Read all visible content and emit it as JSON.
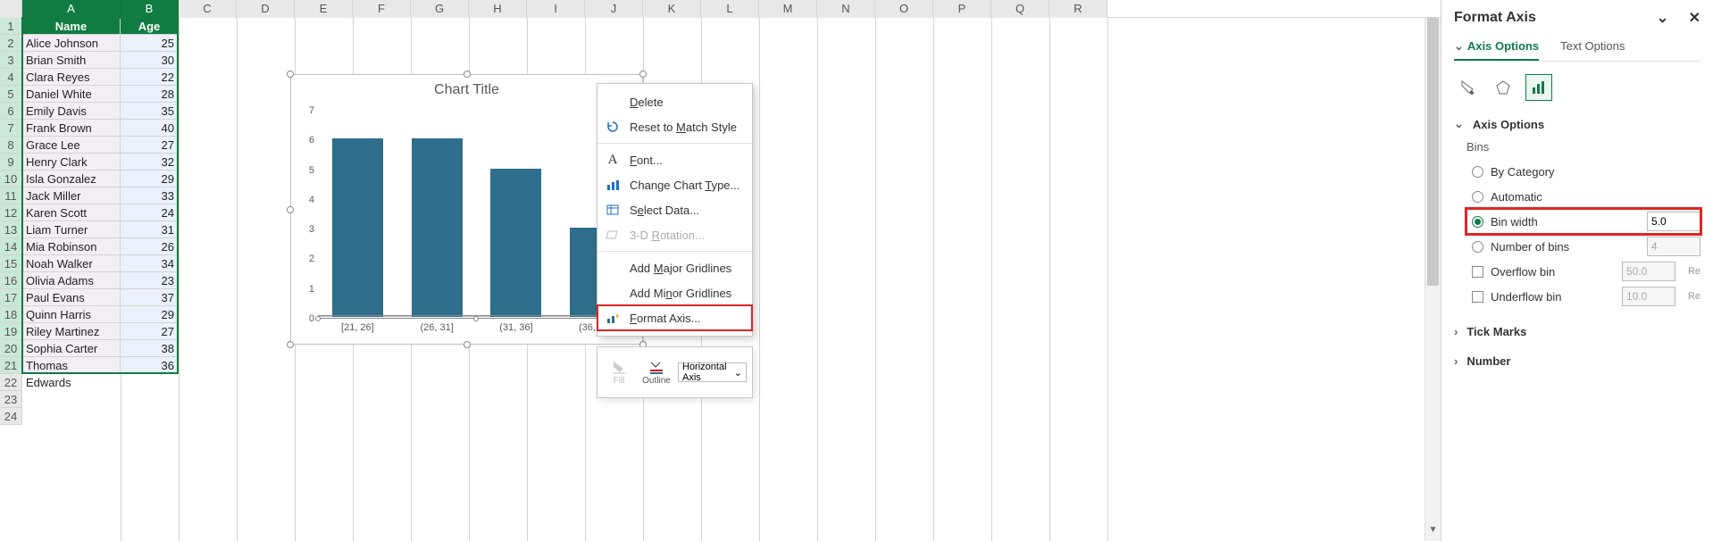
{
  "columns": [
    "A",
    "B",
    "C",
    "D",
    "E",
    "F",
    "G",
    "H",
    "I",
    "J",
    "K",
    "L",
    "M",
    "N",
    "O",
    "P",
    "Q",
    "R"
  ],
  "col_widths": {
    "A": 110,
    "B": 65
  },
  "default_col_width": 65,
  "headers": {
    "A": "Name",
    "B": "Age"
  },
  "rows": [
    {
      "name": "Alice Johnson",
      "age": 25
    },
    {
      "name": "Brian Smith",
      "age": 30
    },
    {
      "name": "Clara Reyes",
      "age": 22
    },
    {
      "name": "Daniel White",
      "age": 28
    },
    {
      "name": "Emily Davis",
      "age": 35
    },
    {
      "name": "Frank Brown",
      "age": 40
    },
    {
      "name": "Grace Lee",
      "age": 27
    },
    {
      "name": "Henry Clark",
      "age": 32
    },
    {
      "name": "Isla Gonzalez",
      "age": 29
    },
    {
      "name": "Jack Miller",
      "age": 33
    },
    {
      "name": "Karen Scott",
      "age": 24
    },
    {
      "name": "Liam Turner",
      "age": 31
    },
    {
      "name": "Mia Robinson",
      "age": 26
    },
    {
      "name": "Noah Walker",
      "age": 34
    },
    {
      "name": "Olivia Adams",
      "age": 23
    },
    {
      "name": "Paul Evans",
      "age": 37
    },
    {
      "name": "Quinn Harris",
      "age": 29
    },
    {
      "name": "Riley Martinez",
      "age": 27
    },
    {
      "name": "Sophia Carter",
      "age": 38
    },
    {
      "name": "Thomas Edwards",
      "age": 36
    }
  ],
  "visible_blank_rows": 3,
  "chart": {
    "title": "Chart Title",
    "y_ticks": [
      0,
      1,
      2,
      3,
      4,
      5,
      6,
      7
    ],
    "categories": [
      "[21, 26]",
      "(26, 31]",
      "(31, 36]",
      "(36, 41]"
    ],
    "values": [
      6,
      6,
      5,
      3
    ]
  },
  "context_menu": {
    "items": [
      {
        "label": "Delete",
        "u_index": 0,
        "icon": null,
        "enabled": true
      },
      {
        "label": "Reset to Match Style",
        "u_index": 9,
        "icon": "reset",
        "enabled": true
      },
      {
        "sep": true
      },
      {
        "label": "Font...",
        "u_index": 0,
        "icon": "font",
        "enabled": true
      },
      {
        "label": "Change Chart Type...",
        "u_index": 13,
        "icon": "chart-type",
        "enabled": true
      },
      {
        "label": "Select Data...",
        "u_index": 1,
        "icon": "select-data",
        "enabled": true
      },
      {
        "label": "3-D Rotation...",
        "u_index": 4,
        "icon": "rotate-3d",
        "enabled": false
      },
      {
        "sep": true
      },
      {
        "label": "Add Major Gridlines",
        "u_index": 4,
        "icon": null,
        "enabled": true
      },
      {
        "label": "Add Minor Gridlines",
        "u_index": 6,
        "icon": null,
        "enabled": true
      },
      {
        "label": "Format Axis...",
        "u_index": 0,
        "icon": "format-axis",
        "enabled": true,
        "highlight": true
      }
    ]
  },
  "mini_toolbar": {
    "fill": "Fill",
    "outline": "Outline",
    "dropdown": "Horizontal Axis"
  },
  "panel": {
    "title": "Format Axis",
    "tab_axis": "Axis Options",
    "tab_text": "Text Options",
    "section_axis_options": "Axis Options",
    "bins_label": "Bins",
    "opt_by_category": "By Category",
    "opt_automatic": "Automatic",
    "opt_bin_width": "Bin width",
    "bin_width_value": "5.0",
    "opt_num_bins": "Number of bins",
    "num_bins_value": "4",
    "opt_overflow": "Overflow bin",
    "overflow_value": "50.0",
    "opt_underflow": "Underflow bin",
    "underflow_value": "10.0",
    "reset": "Re",
    "section_tick": "Tick Marks",
    "section_number": "Number"
  },
  "chart_data": {
    "type": "bar",
    "title": "Chart Title",
    "categories": [
      "[21, 26]",
      "(26, 31]",
      "(31, 36]",
      "(36, 41]"
    ],
    "values": [
      6,
      6,
      5,
      3
    ],
    "ylim": [
      0,
      7
    ],
    "xlabel": "",
    "ylabel": ""
  }
}
